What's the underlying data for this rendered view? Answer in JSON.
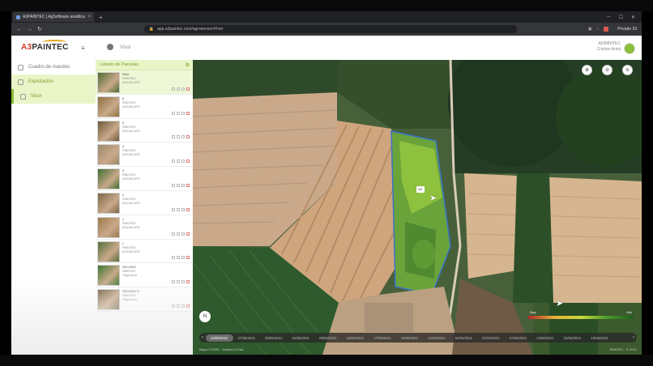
{
  "browser": {
    "tab_title": "A3PAINTEC | AgSoftware analitica",
    "url": "app.a3paintec.com/agrosensor/#/ver",
    "profile": "Privado 33"
  },
  "app": {
    "logo_brand": "A3",
    "logo_text": "PAINTEC",
    "header_title": "Visor",
    "user_name": "ADMIN/TEC",
    "user_sub": "Cristian Antol"
  },
  "sidebar": {
    "items": [
      {
        "label": "Cuadro de mandos",
        "icon": "home-icon"
      },
      {
        "label": "Explotación",
        "icon": "farmer-icon"
      },
      {
        "label": "Visor",
        "icon": "map-icon"
      }
    ]
  },
  "parcel_list": {
    "title": "Listado de Parcelas",
    "rows": [
      {
        "name": "Maiz",
        "l1": "PAINTEC",
        "l2": "AGUACATE",
        "thumb": "#4f6b34"
      },
      {
        "name": "6",
        "l1": "PAINTEC",
        "l2": "AGUACATE",
        "thumb": "#8e6f3f"
      },
      {
        "name": "5",
        "l1": "PAINTEC",
        "l2": "AGUACATE",
        "thumb": "#6d5a3a"
      },
      {
        "name": "4",
        "l1": "PAINTEC",
        "l2": "AGUACATE",
        "thumb": "#9a8a6a"
      },
      {
        "name": "3",
        "l1": "PAINTEC",
        "l2": "AGUACATE",
        "thumb": "#3f6e30"
      },
      {
        "name": "2",
        "l1": "PAINTEC",
        "l2": "AGUACATE",
        "thumb": "#7a6848"
      },
      {
        "name": "1",
        "l1": "PAINTEC",
        "l2": "AGUACATE",
        "thumb": "#9c7a4c"
      },
      {
        "name": "L",
        "l1": "PAINTEC",
        "l2": "AGUACATE",
        "thumb": "#56703c"
      },
      {
        "name": "SECANO",
        "l1": "PAINTEC",
        "l2": "Trigo duro",
        "thumb": "#3d7a32"
      },
      {
        "name": "SECANO D",
        "l1": "PAINTEC",
        "l2": "Trigo duro",
        "thumb": "#6a5a3a"
      }
    ]
  },
  "map": {
    "marker_label": "N1",
    "legend_low": "Bajo",
    "legend_high": "Alto",
    "compass": "N",
    "timeline_dates": [
      "24/05/2021",
      "27/05/2021",
      "29/05/2021",
      "01/06/2021",
      "08/06/2021",
      "14/06/2021",
      "17/06/2021",
      "19/06/2021",
      "24/06/2021",
      "04/06/2021",
      "01/06/2021",
      "27/06/2021",
      "24/06/2021",
      "22/06/2021",
      "19/06/2021"
    ],
    "footer_left": "Mapa © ESRI · Sentinel-2 Esa",
    "footer_right": "PAINTEC · © 2021"
  }
}
